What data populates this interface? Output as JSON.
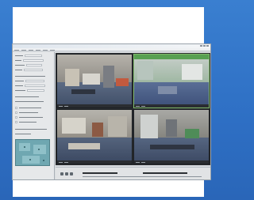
{
  "colors": {
    "background": "#2e6fc4",
    "card": "#ffffff",
    "window_chrome": "#d9dcdf",
    "sidebar": "#e6e8ea",
    "map": "#6fa7b1",
    "video_grid": "#2a2d31",
    "selected_tile_border": "#7fb86a"
  },
  "app": {
    "window_controls": [
      "minimize-icon",
      "maximize-icon",
      "close-icon"
    ],
    "menu_item_count": 6,
    "sidebar_rows": 14
  },
  "camera_tiles": [
    {
      "name": "camera-tile-1",
      "scene": "office-room",
      "selected": false
    },
    {
      "name": "camera-tile-2",
      "scene": "hallway-green-wall",
      "selected": true
    },
    {
      "name": "camera-tile-3",
      "scene": "classroom",
      "selected": false
    },
    {
      "name": "camera-tile-4",
      "scene": "corridor",
      "selected": false
    }
  ],
  "icons": {
    "map": "floor-map-icon",
    "play": "play-icon",
    "rewind": "rewind-icon",
    "forward": "forward-icon"
  }
}
